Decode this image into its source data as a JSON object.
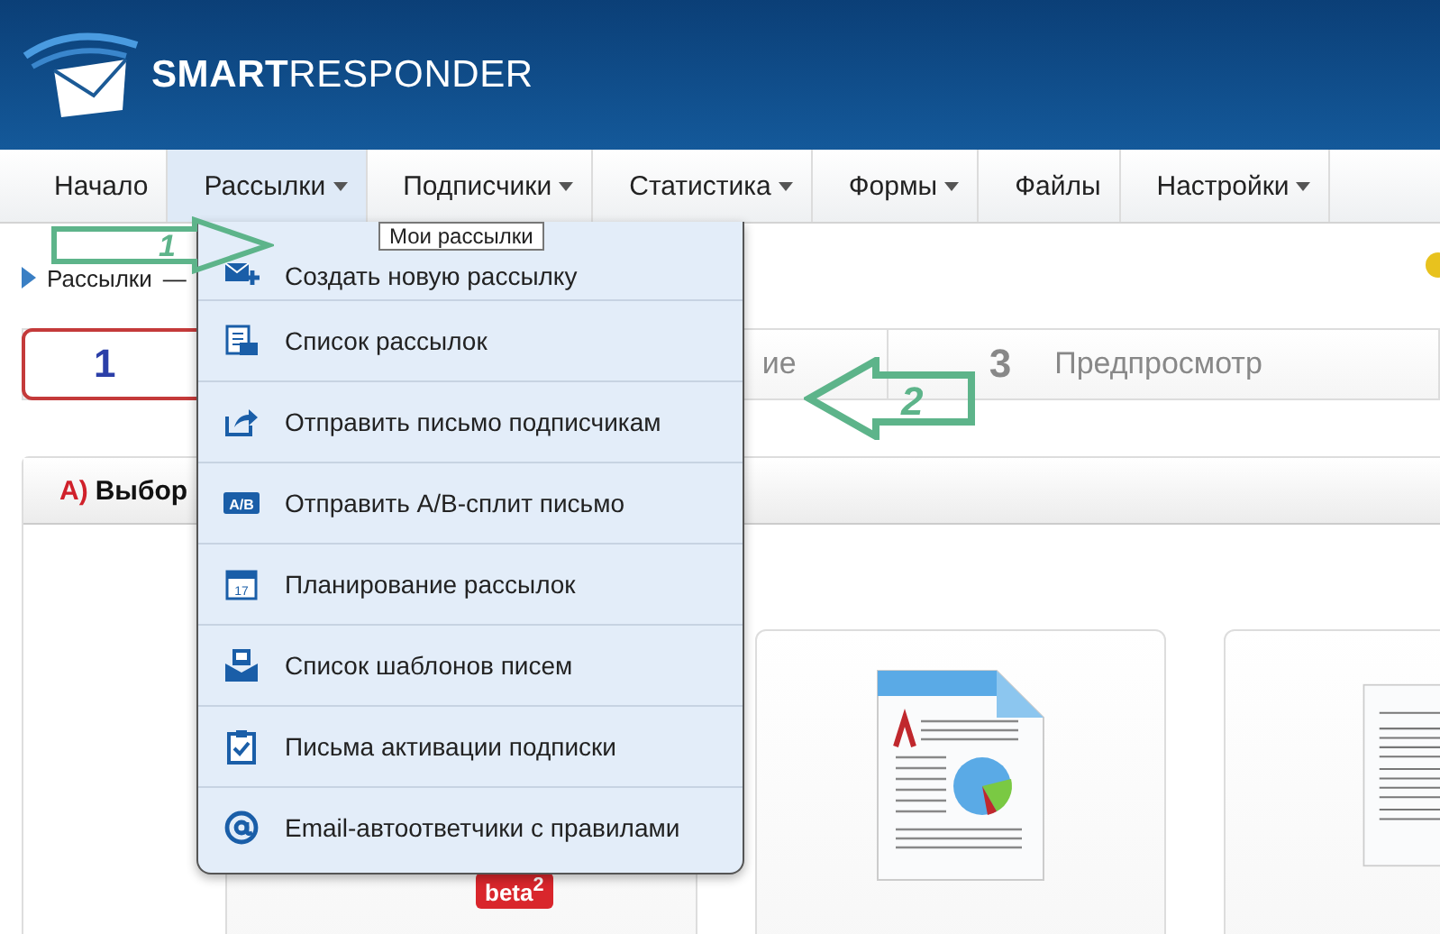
{
  "logo": {
    "text": "**SMART**RESPONDER"
  },
  "nav": [
    {
      "label": "Начало",
      "dropdown": false,
      "selected": false
    },
    {
      "label": "Рассылки",
      "dropdown": true,
      "selected": true
    },
    {
      "label": "Подписчики",
      "dropdown": true,
      "selected": false
    },
    {
      "label": "Статистика",
      "dropdown": true,
      "selected": false
    },
    {
      "label": "Формы",
      "dropdown": true,
      "selected": false
    },
    {
      "label": "Файлы",
      "dropdown": false,
      "selected": false
    },
    {
      "label": "Настройки",
      "dropdown": true,
      "selected": false
    }
  ],
  "breadcrumb": {
    "label": "Рассылки",
    "separator": "—"
  },
  "steps": [
    {
      "number": "1",
      "selected": true
    },
    {
      "label": "ие",
      "selected": false
    },
    {
      "number": "3",
      "label": "Предпросмотр",
      "selected": false
    }
  ],
  "section": {
    "marker": "А)",
    "title": "Выбор"
  },
  "cards": [
    {
      "kind": "hidden",
      "badge": "beta$^{2}$"
    },
    {
      "kind": "report"
    },
    {
      "kind": "letter"
    }
  ],
  "dropdown": {
    "tooltip": "Мои рассылки",
    "items": [
      {
        "kind": "mail-plus",
        "label": "Создать новую рассылку"
      },
      {
        "kind": "list",
        "label": "Список рассылок"
      },
      {
        "kind": "share",
        "label": "Отправить письмо подписчикам"
      },
      {
        "kind": "ab",
        "label": "Отправить A/B-сплит письмо",
        "icon_text": "A/B"
      },
      {
        "kind": "calendar",
        "label": "Планирование рассылок",
        "icon_text": "17"
      },
      {
        "kind": "template",
        "label": "Список шаблонов писем"
      },
      {
        "kind": "clipboard",
        "label": "Письма активации подписки"
      },
      {
        "kind": "at",
        "label": "Email-автоответчики с правилами"
      }
    ]
  },
  "annotations": [
    {
      "kind": "right",
      "label": "1"
    },
    {
      "kind": "left",
      "label": "2"
    }
  ]
}
